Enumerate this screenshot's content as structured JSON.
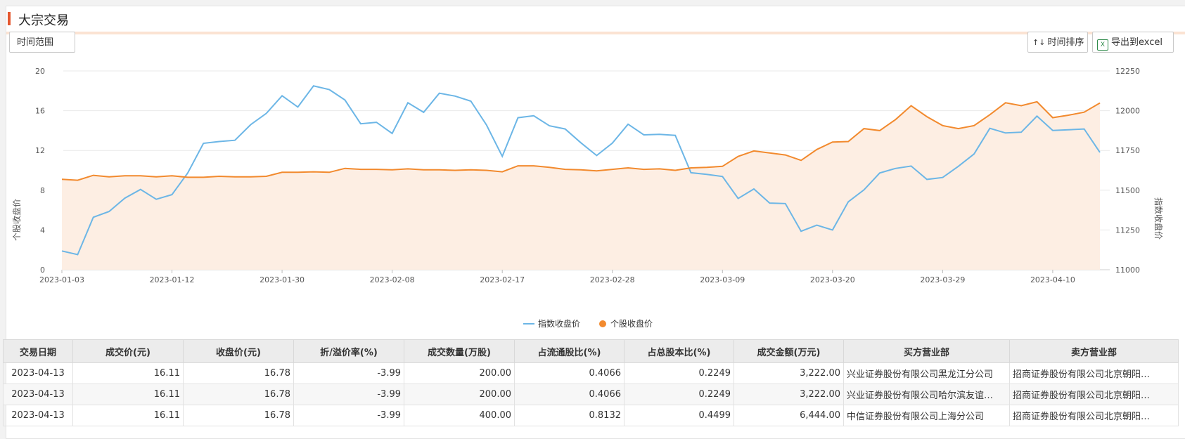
{
  "header": {
    "title": "大宗交易"
  },
  "toolbar": {
    "range_label": "时间范围",
    "sort_label": "时间排序",
    "export_label": "导出到excel"
  },
  "colors": {
    "index_line": "#6cb6e6",
    "stock_line": "#f28a2e",
    "stock_fill": "#fdeee3",
    "accent": "#e4572e"
  },
  "chart_data": {
    "type": "line",
    "ylabel_left": "个股收盘价",
    "ylabel_right": "指数收盘价",
    "ylim_left": [
      0,
      20
    ],
    "ylim_right": [
      11000,
      12250
    ],
    "yticks_left": [
      "0",
      "4",
      "8",
      "12",
      "16",
      "20"
    ],
    "yticks_right": [
      "11000",
      "11250",
      "11500",
      "11750",
      "12000",
      "12250"
    ],
    "xticks": [
      "2023-01-03",
      "2023-01-12",
      "2023-01-30",
      "2023-02-08",
      "2023-02-17",
      "2023-02-28",
      "2023-03-09",
      "2023-03-20",
      "2023-03-29",
      "2023-04-10"
    ],
    "xtick_index": [
      0,
      7,
      14,
      21,
      28,
      35,
      42,
      49,
      56,
      63
    ],
    "legend": [
      "指数收盘价",
      "个股收盘价"
    ],
    "legend_position": "bottom-center",
    "grid": true,
    "series": [
      {
        "name": "指数收盘价",
        "axis": "right",
        "values": [
          11118,
          11095,
          11330,
          11366,
          11450,
          11505,
          11443,
          11472,
          11608,
          11795,
          11806,
          11814,
          11912,
          11983,
          12094,
          12023,
          12156,
          12133,
          12067,
          11918,
          11927,
          11857,
          12050,
          11990,
          12110,
          12092,
          12060,
          11910,
          11713,
          11956,
          11968,
          11905,
          11885,
          11798,
          11718,
          11796,
          11915,
          11848,
          11851,
          11845,
          11610,
          11600,
          11586,
          11448,
          11508,
          11419,
          11416,
          11242,
          11280,
          11250,
          11427,
          11502,
          11608,
          11637,
          11652,
          11568,
          11580,
          11650,
          11728,
          11889,
          11860,
          11865,
          11966,
          11876,
          11880,
          11885,
          11738
        ]
      },
      {
        "name": "个股收盘价",
        "axis": "left",
        "values": [
          9.1,
          9.0,
          9.5,
          9.35,
          9.45,
          9.45,
          9.35,
          9.45,
          9.3,
          9.3,
          9.4,
          9.35,
          9.35,
          9.4,
          9.8,
          9.8,
          9.85,
          9.8,
          10.2,
          10.1,
          10.1,
          10.05,
          10.15,
          10.05,
          10.05,
          10.0,
          10.05,
          10.0,
          9.85,
          10.45,
          10.45,
          10.3,
          10.1,
          10.05,
          9.95,
          10.1,
          10.25,
          10.1,
          10.15,
          10.0,
          10.25,
          10.3,
          10.4,
          11.4,
          11.95,
          11.75,
          11.55,
          11.0,
          12.1,
          12.85,
          12.9,
          14.2,
          14.0,
          15.1,
          16.5,
          15.4,
          14.5,
          14.2,
          14.5,
          15.6,
          16.8,
          16.5,
          16.9,
          15.3,
          15.55,
          15.85,
          16.78
        ]
      }
    ]
  },
  "table": {
    "headers": [
      "交易日期",
      "成交价(元)",
      "收盘价(元)",
      "折/溢价率(%)",
      "成交数量(万股)",
      "占流通股比(%)",
      "占总股本比(%)",
      "成交金额(万元)",
      "买方营业部",
      "卖方营业部"
    ],
    "rows": [
      [
        "2023-04-13",
        "16.11",
        "16.78",
        "-3.99",
        "200.00",
        "0.4066",
        "0.2249",
        "3,222.00",
        "兴业证券股份有限公司黑龙江分公司",
        "招商证券股份有限公司北京朝阳…"
      ],
      [
        "2023-04-13",
        "16.11",
        "16.78",
        "-3.99",
        "200.00",
        "0.4066",
        "0.2249",
        "3,222.00",
        "兴业证券股份有限公司哈尔滨友谊…",
        "招商证券股份有限公司北京朝阳…"
      ],
      [
        "2023-04-13",
        "16.11",
        "16.78",
        "-3.99",
        "400.00",
        "0.8132",
        "0.4499",
        "6,444.00",
        "中信证券股份有限公司上海分公司",
        "招商证券股份有限公司北京朝阳…"
      ]
    ]
  }
}
